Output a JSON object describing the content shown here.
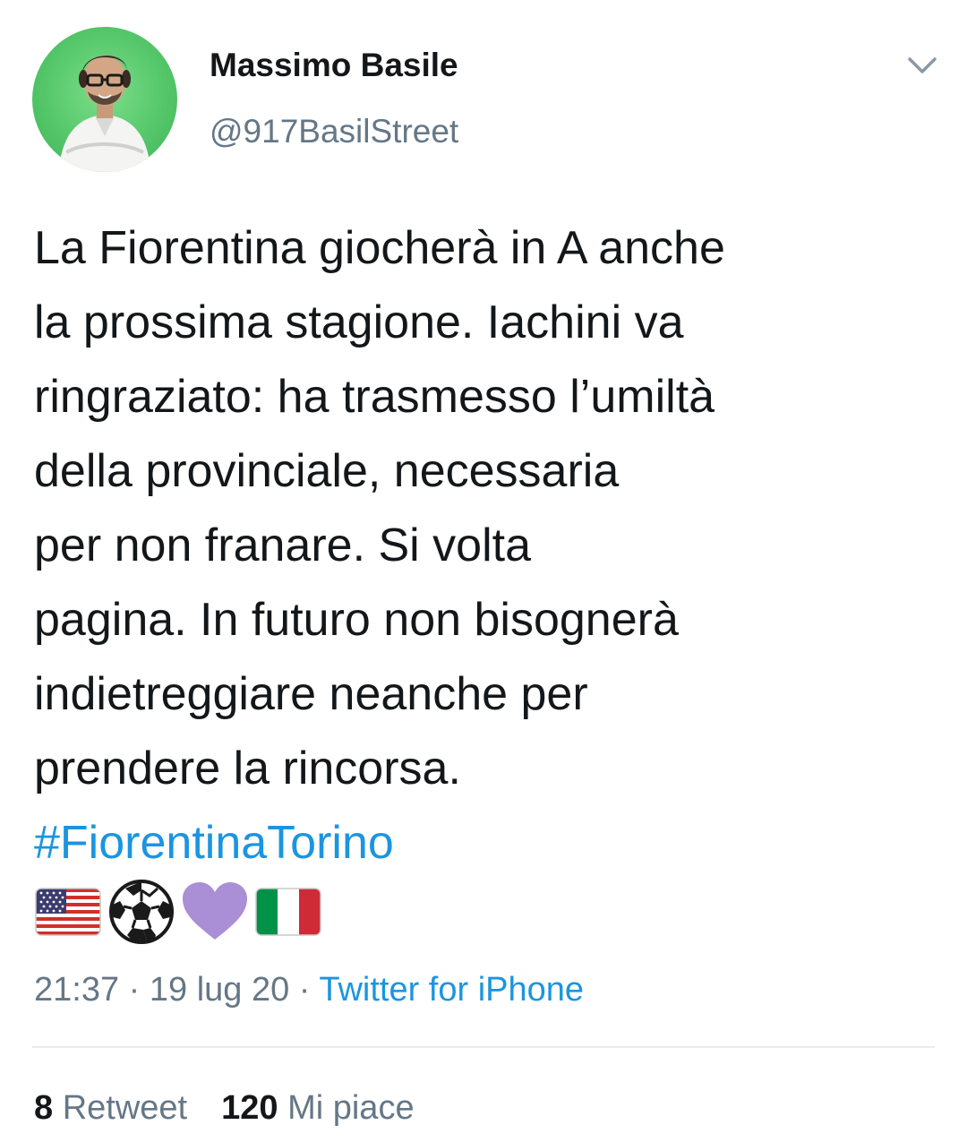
{
  "user": {
    "display_name": "Massimo Basile",
    "handle": "@917BasilStreet"
  },
  "tweet": {
    "lines": [
      "La Fiorentina giocherà in A anche",
      "la prossima stagione. Iachini va",
      "ringraziato: ha trasmesso l’umiltà",
      "della provinciale, necessaria",
      "per non franare. Si volta",
      "pagina. In futuro non bisognerà",
      "indietreggiare neanche per",
      "prendere la rincorsa."
    ],
    "hashtag": "#FiorentinaTorino",
    "emojis": [
      "us-flag-icon",
      "soccer-ball-icon",
      "purple-heart-icon",
      "italy-flag-icon"
    ]
  },
  "meta": {
    "time": "21:37",
    "separator": " · ",
    "date": "19 lug 20",
    "source": "Twitter for iPhone"
  },
  "stats": {
    "retweets_count": "8",
    "retweets_label": "Retweet",
    "likes_count": "120",
    "likes_label": "Mi piace"
  },
  "colors": {
    "link": "#1b95e0",
    "secondary_text": "#657786",
    "primary_text": "#14171a",
    "divider": "#e6ecf0",
    "avatar_bg": "#55c76a"
  }
}
